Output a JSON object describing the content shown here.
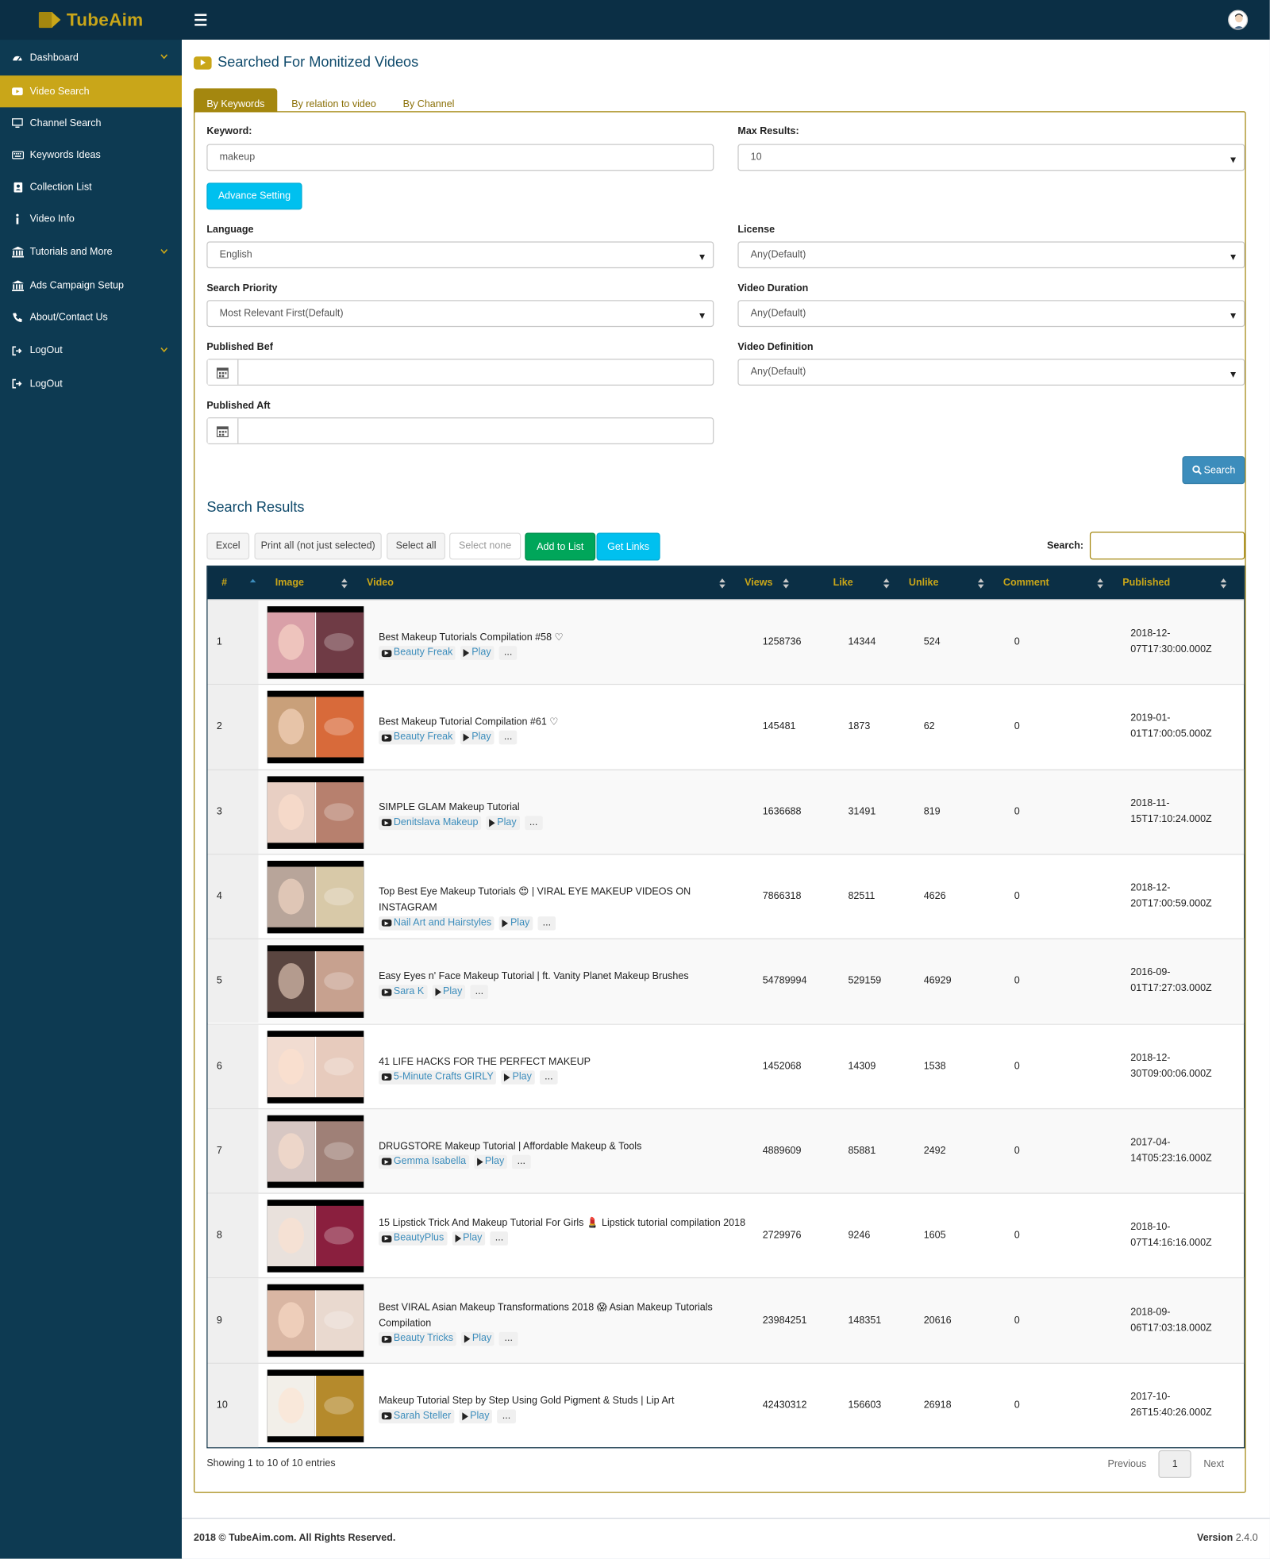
{
  "app": {
    "logo_text": "TubeAim"
  },
  "sidebar": {
    "items": [
      {
        "label": "Dashboard",
        "icon": "dashboard-icon",
        "chevron": true
      },
      {
        "label": "Video Search",
        "icon": "youtube-icon",
        "active": true
      },
      {
        "label": "Channel Search",
        "icon": "monitor-icon"
      },
      {
        "label": "Keywords Ideas",
        "icon": "keyboard-icon"
      },
      {
        "label": "Collection List",
        "icon": "address-book-icon"
      },
      {
        "label": "Video Info",
        "icon": "info-icon"
      },
      {
        "label": "Tutorials and More",
        "icon": "bank-icon",
        "chevron": true
      },
      {
        "label": "Ads Campaign Setup",
        "icon": "bank-icon"
      },
      {
        "label": "About/Contact Us",
        "icon": "phone-icon"
      },
      {
        "label": "LogOut",
        "icon": "sign-out-icon",
        "chevron": true
      },
      {
        "label": "LogOut",
        "icon": "sign-out-icon"
      }
    ]
  },
  "page": {
    "title": "Searched For Monitized Videos"
  },
  "tabs": [
    "By Keywords",
    "By relation to video",
    "By Channel"
  ],
  "form": {
    "keyword_label": "Keyword:",
    "keyword_value": "makeup",
    "max_results_label": "Max Results:",
    "max_results_value": "10",
    "advance_setting": "Advance Setting",
    "language_label": "Language",
    "language_value": "English",
    "license_label": "License",
    "license_value": "Any(Default)",
    "priority_label": "Search Priority",
    "priority_value": "Most Relevant First(Default)",
    "duration_label": "Video Duration",
    "duration_value": "Any(Default)",
    "published_bef_label": "Published Bef",
    "definition_label": "Video Definition",
    "definition_value": "Any(Default)",
    "published_aft_label": "Published Aft",
    "search_button": "Search"
  },
  "results": {
    "title": "Search Results",
    "buttons": {
      "excel": "Excel",
      "print": "Print all (not just selected)",
      "select_all": "Select all",
      "select_none": "Select none",
      "add_to_list": "Add to List",
      "get_links": "Get Links"
    },
    "search_label": "Search:",
    "columns": [
      "#",
      "Image",
      "Video",
      "Views",
      "Like",
      "Unlike",
      "Comment",
      "Published"
    ],
    "play_label": "Play",
    "more_label": "...",
    "rows": [
      {
        "n": "1",
        "title": "Best Makeup Tutorials Compilation #58 ♡",
        "channel": "Beauty Freak",
        "views": "1258736",
        "like": "14344",
        "unlike": "524",
        "comment": "0",
        "pub1": "2018-12-",
        "pub2": "07T17:30:00.000Z",
        "thumb": [
          "#d9a0a8",
          "#6f3b45"
        ]
      },
      {
        "n": "2",
        "title": "Best Makeup Tutorial Compilation #61 ♡",
        "channel": "Beauty Freak",
        "views": "145481",
        "like": "1873",
        "unlike": "62",
        "comment": "0",
        "pub1": "2019-01-",
        "pub2": "01T17:00:05.000Z",
        "thumb": [
          "#c9a07a",
          "#d86a3a"
        ]
      },
      {
        "n": "3",
        "title": "SIMPLE GLAM Makeup Tutorial",
        "channel": "Denitslava Makeup",
        "views": "1636688",
        "like": "31491",
        "unlike": "819",
        "comment": "0",
        "pub1": "2018-11-",
        "pub2": "15T17:10:24.000Z",
        "thumb": [
          "#e8cfc3",
          "#b7806e"
        ]
      },
      {
        "n": "4",
        "title": "Top Best Eye Makeup Tutorials 😍 | VIRAL EYE MAKEUP VIDEOS ON INSTAGRAM",
        "channel": "Nail Art and Hairstyles",
        "views": "7866318",
        "like": "82511",
        "unlike": "4626",
        "comment": "0",
        "pub1": "2018-12-",
        "pub2": "20T17:00:59.000Z",
        "thumb": [
          "#b8a59a",
          "#d8c9a8"
        ]
      },
      {
        "n": "5",
        "title": "Easy Eyes n' Face Makeup Tutorial | ft. Vanity Planet Makeup Brushes",
        "channel": "Sara K",
        "views": "54789994",
        "like": "529159",
        "unlike": "46929",
        "comment": "0",
        "pub1": "2016-09-",
        "pub2": "01T17:27:03.000Z",
        "thumb": [
          "#5a4540",
          "#c7a18f"
        ]
      },
      {
        "n": "6",
        "title": "41 LIFE HACKS FOR THE PERFECT MAKEUP",
        "channel": "5-Minute Crafts GIRLY",
        "views": "1452068",
        "like": "14309",
        "unlike": "1538",
        "comment": "0",
        "pub1": "2018-12-",
        "pub2": "30T09:00:06.000Z",
        "thumb": [
          "#f1dcd1",
          "#e7cbbd"
        ]
      },
      {
        "n": "7",
        "title": "DRUGSTORE Makeup Tutorial | Affordable Makeup & Tools",
        "channel": "Gemma Isabella",
        "views": "4889609",
        "like": "85881",
        "unlike": "2492",
        "comment": "0",
        "pub1": "2017-04-",
        "pub2": "14T05:23:16.000Z",
        "thumb": [
          "#d7c7c3",
          "#9f8077"
        ]
      },
      {
        "n": "8",
        "title": "15 Lipstick Trick And Makeup Tutorial For Girls 💄 Lipstick tutorial compilation 2018",
        "channel": "BeautyPlus",
        "views": "2729976",
        "like": "9246",
        "unlike": "1605",
        "comment": "0",
        "pub1": "2018-10-",
        "pub2": "07T14:16:16.000Z",
        "thumb": [
          "#e9e1dc",
          "#8a1f3e"
        ]
      },
      {
        "n": "9",
        "title": "Best VIRAL Asian Makeup Transformations 2018 😱 Asian Makeup Tutorials Compilation",
        "channel": "Beauty Tricks",
        "views": "23984251",
        "like": "148351",
        "unlike": "20616",
        "comment": "0",
        "pub1": "2018-09-",
        "pub2": "06T17:03:18.000Z",
        "thumb": [
          "#d9b6a3",
          "#e9d9cf"
        ]
      },
      {
        "n": "10",
        "title": "Makeup Tutorial Step by Step Using Gold Pigment & Studs | Lip Art",
        "channel": "Sarah Steller",
        "views": "42430312",
        "like": "156603",
        "unlike": "26918",
        "comment": "0",
        "pub1": "2017-10-",
        "pub2": "26T15:40:26.000Z",
        "thumb": [
          "#f2efe9",
          "#b58a2c"
        ]
      }
    ],
    "showing": "Showing 1 to 10 of 10 entries",
    "pagination": {
      "previous": "Previous",
      "current": "1",
      "next": "Next"
    }
  },
  "footer": {
    "copyright": "2018 © TubeAim.com. All Rights Reserved.",
    "version_label": "Version",
    "version": "2.4.0"
  },
  "colors": {
    "sidebar": "#0d3a52",
    "topbar": "#0b2f45",
    "accent": "#c9a619",
    "accent_dark": "#a4870f",
    "link": "#3c8dbc"
  }
}
